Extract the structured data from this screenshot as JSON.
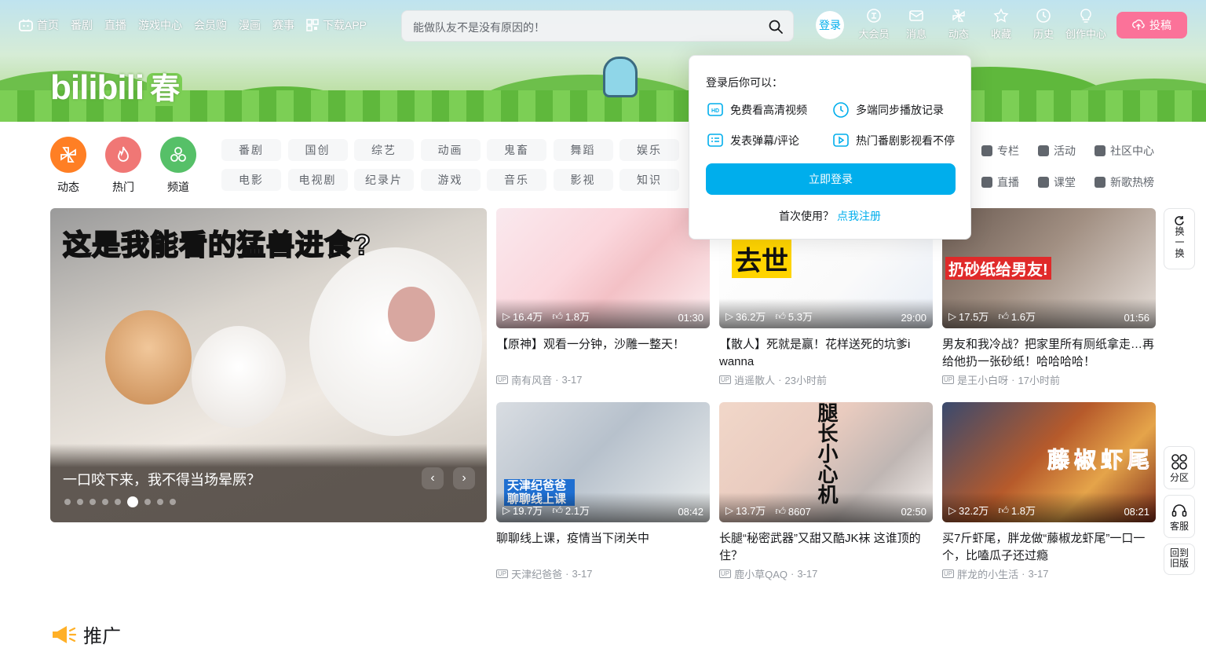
{
  "header": {
    "nav_left": [
      "首页",
      "番剧",
      "直播",
      "游戏中心",
      "会员购",
      "漫画",
      "赛事",
      "下载APP"
    ],
    "search_placeholder": "能做队友不是没有原因的！",
    "login_label": "登录",
    "nav_right": [
      "大会员",
      "消息",
      "动态",
      "收藏",
      "历史",
      "创作中心"
    ],
    "upload_label": "投稿"
  },
  "channels": {
    "icons": [
      {
        "label": "动态",
        "color": "#ff6699"
      },
      {
        "label": "热门",
        "color": "#f07775"
      },
      {
        "label": "频道",
        "color": "#56c068"
      }
    ],
    "categories": [
      "番剧",
      "国创",
      "综艺",
      "动画",
      "鬼畜",
      "舞蹈",
      "娱乐",
      "电影",
      "电视剧",
      "纪录片",
      "游戏",
      "音乐",
      "影视",
      "知识"
    ],
    "extra": [
      "专栏",
      "活动",
      "社区中心",
      "直播",
      "课堂",
      "新歌热榜"
    ]
  },
  "carousel": {
    "headline_a": "这是我能看的",
    "headline_b": "猛兽",
    "headline_c": "进食?",
    "caption": "一口咬下来，我不得当场晕厥？",
    "active_dot": 5,
    "dot_count": 9
  },
  "videos": [
    {
      "title": "【原神】观看一分钟，沙雕一整天！",
      "views": "16.4万",
      "likes": "1.8万",
      "duration": "01:30",
      "author": "南有风音",
      "date": "3-17"
    },
    {
      "title": "【散人】死就是赢！花样送死的坑爹i wanna",
      "views": "36.2万",
      "likes": "5.3万",
      "duration": "29:00",
      "author": "逍遥散人",
      "date": "23小时前",
      "thumb_text": "去世"
    },
    {
      "title": "男友和我冷战？把家里所有厕纸拿走…再给他扔一张砂纸！哈哈哈哈！",
      "views": "17.5万",
      "likes": "1.6万",
      "duration": "01:56",
      "author": "是王小白呀",
      "date": "17小时前",
      "thumb_text": "扔砂纸给男友!"
    },
    {
      "title": "聊聊线上课，疫情当下闭关中",
      "views": "19.7万",
      "likes": "2.1万",
      "duration": "08:42",
      "author": "天津纪爸爸",
      "date": "3-17",
      "thumb_text": "天津纪爸爸 聊聊线上课"
    },
    {
      "title": "长腿“秘密武器”又甜又酷JK袜 这谁顶的住？",
      "views": "13.7万",
      "likes": "8607",
      "duration": "02:50",
      "author": "鹿小草QAQ",
      "date": "3-17",
      "thumb_text": "腿长小心机"
    },
    {
      "title": "买7斤虾尾，胖龙做“藤椒龙虾尾”一口一个，比嗑瓜子还过瘾",
      "views": "32.2万",
      "likes": "1.8万",
      "duration": "08:21",
      "author": "胖龙的小生活",
      "date": "3-17",
      "thumb_text": "藤椒虾尾"
    }
  ],
  "popup": {
    "heading": "登录后你可以：",
    "features": [
      "免费看高清视频",
      "多端同步播放记录",
      "发表弹幕/评论",
      "热门番剧影视看不停"
    ],
    "login_button": "立即登录",
    "first_time": "首次使用？",
    "register_link": "点我注册"
  },
  "side_tools": {
    "refresh": "换一换",
    "partition": "分区",
    "service": "客服",
    "old_version": "回到旧版"
  },
  "promo_title": "推广",
  "colors": {
    "brand_pink": "#fb7299",
    "brand_blue": "#00aeec"
  }
}
